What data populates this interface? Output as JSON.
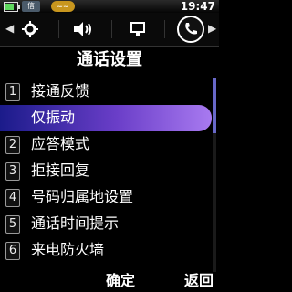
{
  "status": {
    "signal1": "信",
    "signal2": "≈≈",
    "time": "19:47"
  },
  "tabs": {
    "icons": [
      "settings-gear-icon",
      "speaker-icon",
      "monitor-icon",
      "phone-icon"
    ]
  },
  "title": "通话设置",
  "menu": [
    {
      "num": "1",
      "label": "接通反馈"
    },
    {
      "num": "",
      "label": "仅振动"
    },
    {
      "num": "2",
      "label": "应答模式"
    },
    {
      "num": "3",
      "label": "拒接回复"
    },
    {
      "num": "4",
      "label": "号码归属地设置"
    },
    {
      "num": "5",
      "label": "通话时间提示"
    },
    {
      "num": "6",
      "label": "来电防火墙"
    }
  ],
  "softkeys": {
    "left": "确定",
    "right": "返回"
  }
}
